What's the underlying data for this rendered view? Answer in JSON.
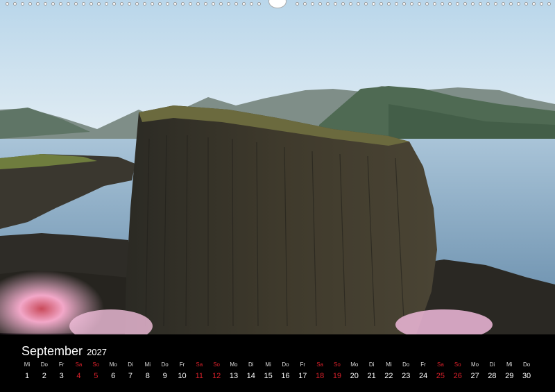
{
  "calendar": {
    "month": "September",
    "year": "2027",
    "weekend_color": "#d8202a",
    "days": [
      {
        "dow": "Mi",
        "num": "1",
        "weekend": false
      },
      {
        "dow": "Do",
        "num": "2",
        "weekend": false
      },
      {
        "dow": "Fr",
        "num": "3",
        "weekend": false
      },
      {
        "dow": "Sa",
        "num": "4",
        "weekend": true
      },
      {
        "dow": "So",
        "num": "5",
        "weekend": true
      },
      {
        "dow": "Mo",
        "num": "6",
        "weekend": false
      },
      {
        "dow": "Di",
        "num": "7",
        "weekend": false
      },
      {
        "dow": "Mi",
        "num": "8",
        "weekend": false
      },
      {
        "dow": "Do",
        "num": "9",
        "weekend": false
      },
      {
        "dow": "Fr",
        "num": "10",
        "weekend": false
      },
      {
        "dow": "Sa",
        "num": "11",
        "weekend": true
      },
      {
        "dow": "So",
        "num": "12",
        "weekend": true
      },
      {
        "dow": "Mo",
        "num": "13",
        "weekend": false
      },
      {
        "dow": "Di",
        "num": "14",
        "weekend": false
      },
      {
        "dow": "Mi",
        "num": "15",
        "weekend": false
      },
      {
        "dow": "Do",
        "num": "16",
        "weekend": false
      },
      {
        "dow": "Fr",
        "num": "17",
        "weekend": false
      },
      {
        "dow": "Sa",
        "num": "18",
        "weekend": true
      },
      {
        "dow": "So",
        "num": "19",
        "weekend": true
      },
      {
        "dow": "Mo",
        "num": "20",
        "weekend": false
      },
      {
        "dow": "Di",
        "num": "21",
        "weekend": false
      },
      {
        "dow": "Mi",
        "num": "22",
        "weekend": false
      },
      {
        "dow": "Do",
        "num": "23",
        "weekend": false
      },
      {
        "dow": "Fr",
        "num": "24",
        "weekend": false
      },
      {
        "dow": "Sa",
        "num": "25",
        "weekend": true
      },
      {
        "dow": "So",
        "num": "26",
        "weekend": true
      },
      {
        "dow": "Mo",
        "num": "27",
        "weekend": false
      },
      {
        "dow": "Di",
        "num": "28",
        "weekend": false
      },
      {
        "dow": "Mi",
        "num": "29",
        "weekend": false
      },
      {
        "dow": "Do",
        "num": "30",
        "weekend": false
      }
    ]
  }
}
